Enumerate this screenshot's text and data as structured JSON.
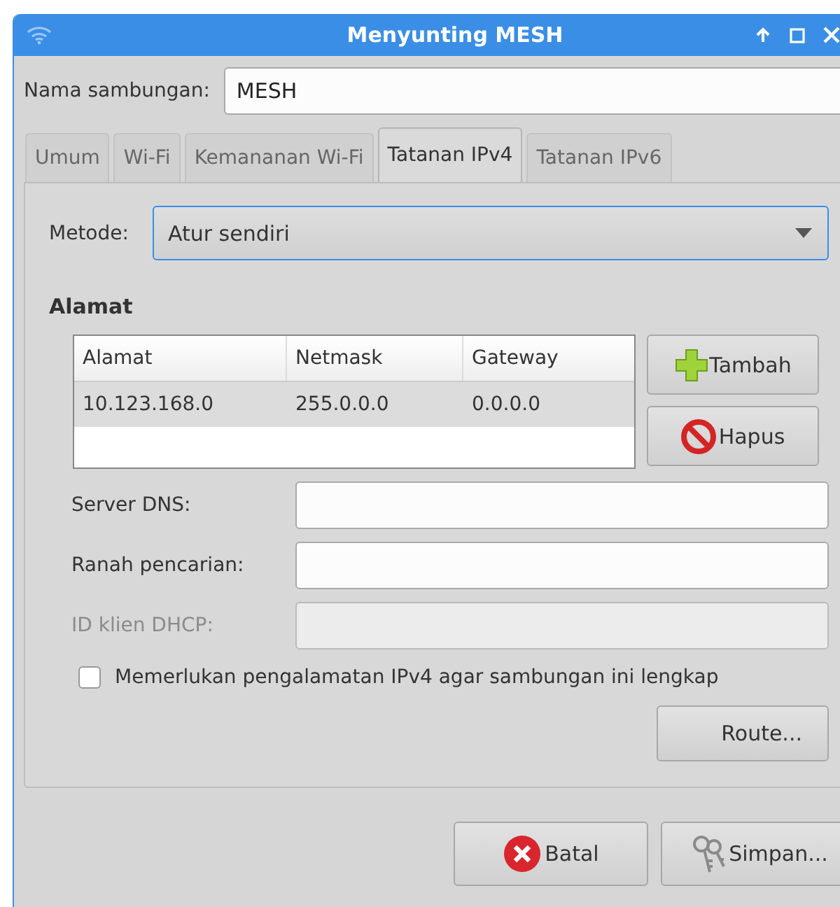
{
  "window": {
    "title": "Menyunting MESH"
  },
  "connection_name": {
    "label": "Nama sambungan:",
    "value": "MESH"
  },
  "tabs": [
    {
      "label": "Umum",
      "selected": false
    },
    {
      "label": "Wi-Fi",
      "selected": false
    },
    {
      "label": "Kemananan Wi-Fi",
      "selected": false
    },
    {
      "label": "Tatanan IPv4",
      "selected": true
    },
    {
      "label": "Tatanan IPv6",
      "selected": false
    }
  ],
  "method": {
    "label": "Metode:",
    "value": "Atur sendiri"
  },
  "addresses": {
    "heading": "Alamat",
    "columns": [
      "Alamat",
      "Netmask",
      "Gateway"
    ],
    "rows": [
      [
        "10.123.168.0",
        "255.0.0.0",
        "0.0.0.0"
      ]
    ],
    "buttons": [
      {
        "label": "Tambah",
        "kind": "add"
      },
      {
        "label": "Hapus",
        "kind": "remove"
      }
    ]
  },
  "fields": [
    {
      "label": "Server DNS:",
      "disabled": false
    },
    {
      "label": "Ranah pencarian:",
      "disabled": false
    },
    {
      "label": "ID klien DHCP:",
      "disabled": true
    }
  ],
  "require_ipv4": {
    "label": "Memerlukan pengalamatan IPv4 agar sambungan ini lengkap",
    "checked": false
  },
  "route_button": "Route...",
  "footer_buttons": [
    {
      "label": "Batal",
      "kind": "cancel"
    },
    {
      "label": "Simpan...",
      "kind": "save"
    }
  ]
}
